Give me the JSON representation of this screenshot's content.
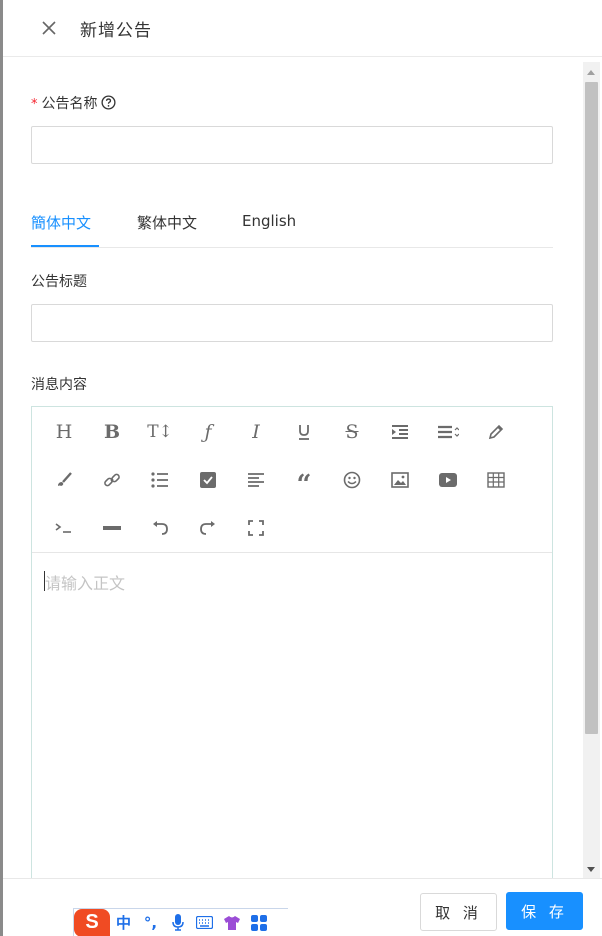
{
  "header": {
    "title": "新增公告"
  },
  "form": {
    "name_label": "公告名称",
    "required_mark": "*",
    "name_value": "",
    "title_label": "公告标题",
    "title_value": "",
    "content_label": "消息内容"
  },
  "tabs": [
    {
      "label": "簡体中文",
      "active": true
    },
    {
      "label": "繁体中文",
      "active": false
    },
    {
      "label": "English",
      "active": false
    }
  ],
  "editor": {
    "placeholder": "请输入正文",
    "toolbar": [
      "heading",
      "bold",
      "font-size",
      "font-family",
      "italic",
      "underline",
      "strikethrough",
      "indent",
      "line-height",
      "background-color",
      "text-color",
      "link",
      "bulleted-list",
      "todo",
      "justify",
      "quote",
      "emoticon",
      "image",
      "video",
      "table",
      "code",
      "divider",
      "undo",
      "redo",
      "fullscreen"
    ]
  },
  "footer": {
    "cancel_label": "取 消",
    "save_label": "保 存"
  },
  "ime": {
    "logo": "S",
    "mode": "中",
    "punct": "°,"
  },
  "colors": {
    "accent": "#1890ff",
    "required": "#f5222d",
    "ime": "#f04b23"
  }
}
